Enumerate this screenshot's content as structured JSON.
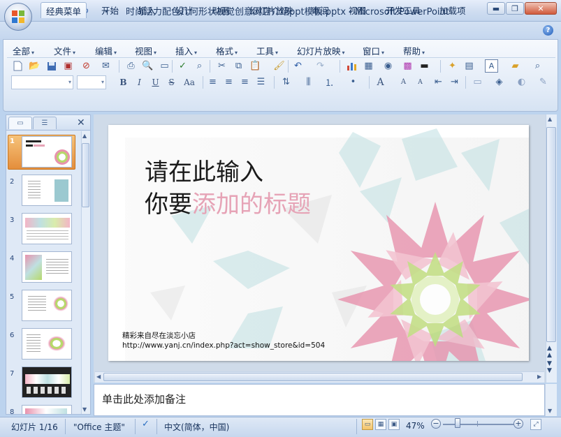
{
  "window": {
    "title": "时尚活力配色几何形状视觉创意网店介绍ppt模板.pptx - Microsoft PowerPoint"
  },
  "ribbon_tabs": [
    "经典菜单",
    "开始",
    "插入",
    "设计",
    "动画",
    "幻灯片放映",
    "审阅",
    "视图",
    "开发工具",
    "加载项"
  ],
  "active_tab": "经典菜单",
  "classic_menu": [
    "全部",
    "文件",
    "编辑",
    "视图",
    "插入",
    "格式",
    "工具",
    "幻灯片放映",
    "窗口",
    "帮助"
  ],
  "format_buttons": {
    "bold": "B",
    "italic": "I",
    "underline": "U",
    "strike": "S",
    "case": "Aa",
    "grow": "A",
    "shrink": "A"
  },
  "panel": {
    "thumbnails": [
      {
        "num": "1",
        "selected": true
      },
      {
        "num": "2"
      },
      {
        "num": "3"
      },
      {
        "num": "4"
      },
      {
        "num": "5"
      },
      {
        "num": "6"
      },
      {
        "num": "7"
      },
      {
        "num": "8"
      }
    ]
  },
  "slide": {
    "title_line1": "请在此输入",
    "title_line2_black": "你要",
    "title_line2_pink": "添加的标题",
    "note_line1": "精彩来自尽在淡忘小店",
    "note_line2": "http://www.yanj.cn/index.php?act=show_store&id=504",
    "colors": {
      "pink": "#e6a3b6",
      "petal_pink": "#e892ad",
      "green": "#b7d96b",
      "teal": "#bfe0e2"
    }
  },
  "notes_placeholder": "单击此处添加备注",
  "status": {
    "slide_counter": "幻灯片 1/16",
    "theme": "\"Office 主题\"",
    "language": "中文(简体，中国)",
    "zoom": "47%",
    "zoom_minus": "−",
    "zoom_plus": "+"
  }
}
